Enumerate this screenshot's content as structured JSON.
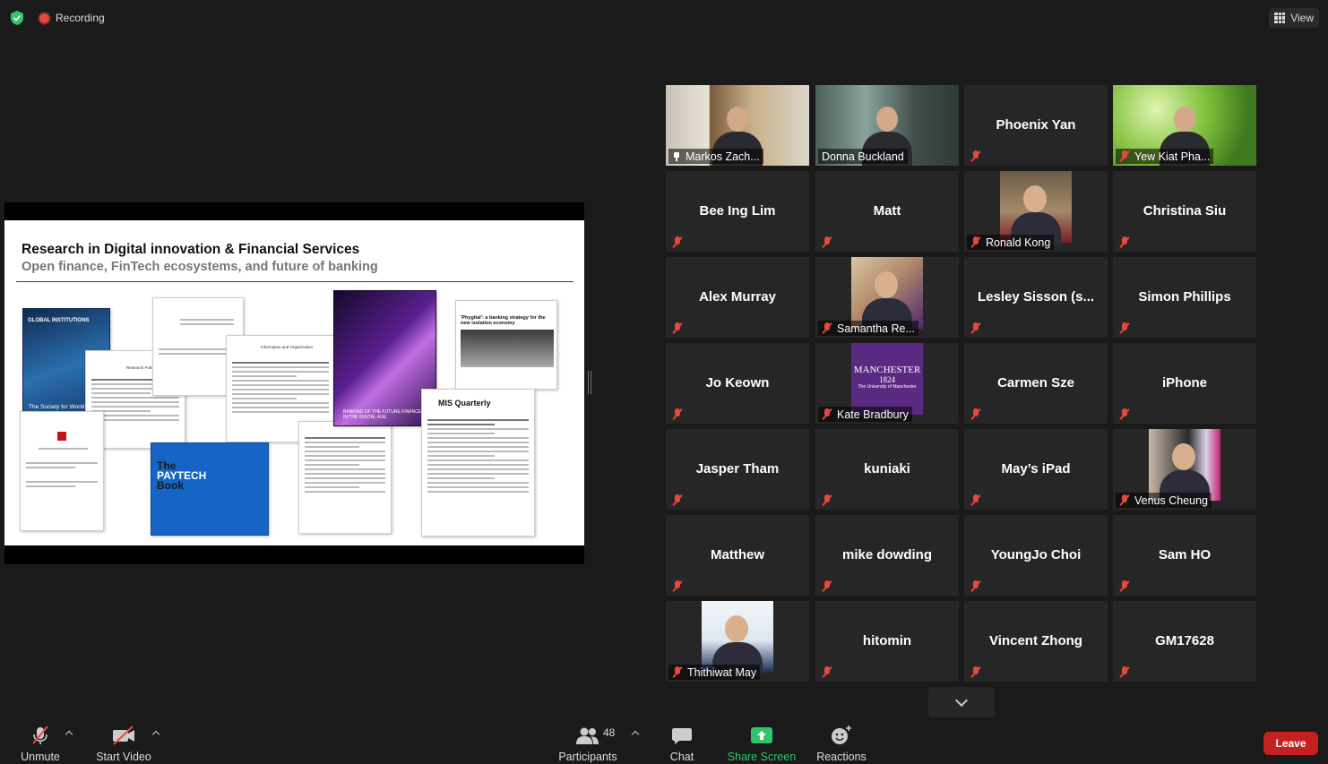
{
  "app": {
    "recording_label": "Recording",
    "view_label": "View",
    "security_icon": "shield-check-icon",
    "colors": {
      "accent_green": "#2ec56b",
      "recording_red": "#e8483c",
      "leave_red": "#c62121",
      "active_speaker": "#d7e54e"
    }
  },
  "slide": {
    "title": "Research in Digital innovation & Financial Services",
    "subtitle": "Open finance, FinTech ecosystems, and future of banking",
    "cover_global": "GLOBAL INSTITUTIONS",
    "cover_society": "The Society for World",
    "cover_banking": "BANKING OF THE FUTURE FINANCE IN THE DIGITAL AGE",
    "cover_paytech_1": "The",
    "cover_paytech_2": "PAYTECH",
    "cover_paytech_3": "Book",
    "cover_misq": "MIS Quarterly",
    "cover_phygital": "'Phygital': a banking strategy for the new isolation economy",
    "cover_research_policy": "Research Policy",
    "cover_info_org": "Information and Organization"
  },
  "participants": [
    {
      "name": "Markos Zach...",
      "video": true,
      "active": true,
      "pinned": true,
      "muted": false
    },
    {
      "name": "Donna Buckland",
      "video": true,
      "muted": false
    },
    {
      "name": "Phoenix Yan",
      "muted": true
    },
    {
      "name": "Yew Kiat Pha...",
      "video": true,
      "muted": true
    },
    {
      "name": "Bee Ing Lim",
      "muted": true
    },
    {
      "name": "Matt",
      "muted": true
    },
    {
      "name": "Ronald Kong",
      "photo": true,
      "muted": true
    },
    {
      "name": "Christina Siu",
      "muted": true
    },
    {
      "name": "Alex Murray",
      "muted": true
    },
    {
      "name": "Samantha Re...",
      "photo": true,
      "muted": true
    },
    {
      "name": "Lesley Sisson (s...",
      "muted": true
    },
    {
      "name": "Simon Phillips",
      "muted": true
    },
    {
      "name": "Jo Keown",
      "muted": true
    },
    {
      "name": "Kate Bradbury",
      "photo": true,
      "muted": true,
      "logo_text_1": "MANCHESTER",
      "logo_text_2": "1824",
      "logo_text_3": "The University of Manchester"
    },
    {
      "name": "Carmen Sze",
      "muted": true
    },
    {
      "name": "iPhone",
      "muted": true
    },
    {
      "name": "Jasper Tham",
      "muted": true
    },
    {
      "name": "kuniaki",
      "muted": true
    },
    {
      "name": "May’s iPad",
      "muted": true
    },
    {
      "name": "Venus Cheung",
      "photo": true,
      "muted": true
    },
    {
      "name": "Matthew",
      "muted": true
    },
    {
      "name": "mike dowding",
      "muted": true
    },
    {
      "name": "YoungJo Choi",
      "muted": true
    },
    {
      "name": "Sam HO",
      "muted": true
    },
    {
      "name": "Thithiwat May",
      "photo": true,
      "muted": true
    },
    {
      "name": "hitomin",
      "muted": true
    },
    {
      "name": "Vincent Zhong",
      "muted": true
    },
    {
      "name": "GM17628",
      "muted": true
    }
  ],
  "toolbar": {
    "unmute": "Unmute",
    "start_video": "Start Video",
    "participants": "Participants",
    "participants_count": "48",
    "chat": "Chat",
    "share_screen": "Share Screen",
    "reactions": "Reactions",
    "leave": "Leave"
  }
}
